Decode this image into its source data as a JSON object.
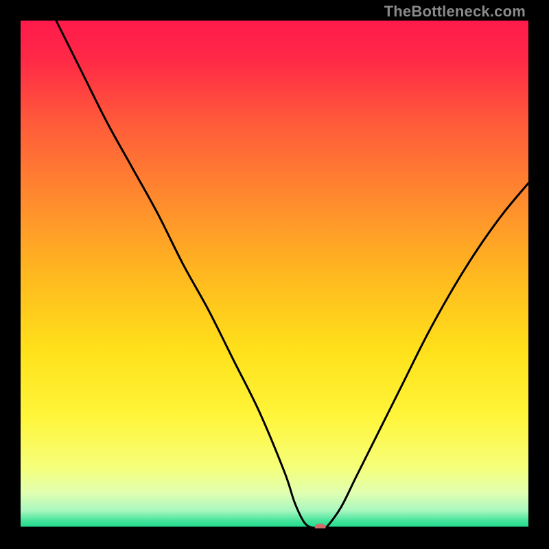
{
  "watermark": "TheBottleneck.com",
  "chart_data": {
    "type": "line",
    "title": "",
    "xlabel": "",
    "ylabel": "",
    "xlim": [
      0,
      100
    ],
    "ylim": [
      0,
      100
    ],
    "grid": false,
    "legend": false,
    "series": [
      {
        "name": "curve",
        "x": [
          7,
          12,
          17,
          22,
          27,
          32,
          37,
          42,
          47,
          52,
          54,
          56,
          58,
          59,
          60,
          63,
          66,
          70,
          75,
          80,
          85,
          90,
          95,
          100
        ],
        "y": [
          100,
          90,
          80,
          71,
          62,
          52,
          43,
          33,
          23,
          11,
          5,
          1,
          0,
          0,
          0,
          4,
          10,
          18,
          28,
          38,
          47,
          55,
          62,
          68
        ]
      }
    ],
    "marker": {
      "x": 59,
      "y": 0,
      "color": "#d36a6a",
      "rx": 8,
      "ry": 5
    },
    "background_gradient": {
      "stops": [
        {
          "offset": 0.0,
          "color": "#ff1a4b"
        },
        {
          "offset": 0.08,
          "color": "#ff2a46"
        },
        {
          "offset": 0.2,
          "color": "#ff5a3a"
        },
        {
          "offset": 0.35,
          "color": "#ff8a2e"
        },
        {
          "offset": 0.5,
          "color": "#ffb81f"
        },
        {
          "offset": 0.65,
          "color": "#ffe11a"
        },
        {
          "offset": 0.78,
          "color": "#fff53a"
        },
        {
          "offset": 0.88,
          "color": "#f6ff7a"
        },
        {
          "offset": 0.93,
          "color": "#e0ffb0"
        },
        {
          "offset": 0.965,
          "color": "#a8f7c0"
        },
        {
          "offset": 0.985,
          "color": "#45e49a"
        },
        {
          "offset": 1.0,
          "color": "#17d989"
        }
      ]
    }
  }
}
